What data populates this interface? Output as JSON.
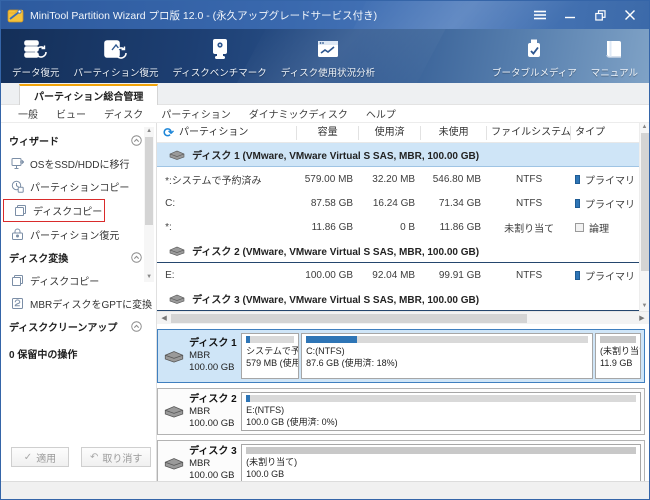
{
  "window": {
    "title": "MiniTool Partition Wizard プロ版 12.0 - (永久アップグレードサービス付き)"
  },
  "toolbar": {
    "items": [
      {
        "label": "データ復元",
        "icon": "data-recovery-icon"
      },
      {
        "label": "パーティション復元",
        "icon": "partition-recovery-icon"
      },
      {
        "label": "ディスクベンチマーク",
        "icon": "disk-benchmark-icon"
      },
      {
        "label": "ディスク使用状況分析",
        "icon": "disk-usage-analysis-icon"
      },
      {
        "label": "ブータブルメディア",
        "icon": "bootable-media-icon"
      },
      {
        "label": "マニュアル",
        "icon": "manual-icon"
      }
    ]
  },
  "tab": {
    "label": "パーティション総合管理"
  },
  "menu": {
    "items": [
      "一般",
      "ビュー",
      "ディスク",
      "パーティション",
      "ダイナミックディスク",
      "ヘルプ"
    ]
  },
  "sidebar": {
    "sections": [
      {
        "title": "ウィザード",
        "items": [
          {
            "label": "OSをSSD/HDDに移行"
          },
          {
            "label": "パーティションコピー"
          },
          {
            "label": "ディスクコピー",
            "highlighted": true
          },
          {
            "label": "パーティション復元"
          }
        ]
      },
      {
        "title": "ディスク変換",
        "items": [
          {
            "label": "ディスクコピー"
          },
          {
            "label": "MBRディスクをGPTに変換"
          }
        ]
      },
      {
        "title": "ディスククリーンアップ",
        "items": []
      }
    ],
    "pending_label": "0 保留中の操作"
  },
  "actions": {
    "apply_label": "適用",
    "undo_label": "取り消す"
  },
  "table": {
    "columns": {
      "name": "パーティション",
      "capacity": "容量",
      "used": "使用済",
      "unused": "未使用",
      "fs": "ファイルシステム",
      "type": "タイプ"
    },
    "disk1": {
      "label": "ディスク 1 (VMware, VMware Virtual S SAS, MBR, 100.00 GB)"
    },
    "disk2": {
      "label": "ディスク 2 (VMware, VMware Virtual S SAS, MBR, 100.00 GB)"
    },
    "disk3": {
      "label": "ディスク 3 (VMware, VMware Virtual S SAS, MBR, 100.00 GB)"
    },
    "rows": [
      {
        "name": "*:システムで予約済み",
        "capacity": "579.00 MB",
        "used": "32.20 MB",
        "unused": "546.80 MB",
        "fs": "NTFS",
        "type": "プライマリ",
        "type_kind": "primary"
      },
      {
        "name": "C:",
        "capacity": "87.58 GB",
        "used": "16.24 GB",
        "unused": "71.34 GB",
        "fs": "NTFS",
        "type": "プライマリ",
        "type_kind": "primary"
      },
      {
        "name": "*:",
        "capacity": "11.86 GB",
        "used": "0 B",
        "unused": "11.86 GB",
        "fs": "未割り当て",
        "type": "論理",
        "type_kind": "logical"
      },
      {
        "name": "E:",
        "capacity": "100.00 GB",
        "used": "92.04 MB",
        "unused": "99.91 GB",
        "fs": "NTFS",
        "type": "プライマリ",
        "type_kind": "primary"
      }
    ]
  },
  "diskmap": {
    "disks": [
      {
        "name": "ディスク 1",
        "scheme": "MBR",
        "size": "100.00 GB",
        "selected": true,
        "blocks": [
          {
            "line1": "システムで予約",
            "line2": "579 MB (使用",
            "usage_pct": 8,
            "kind": "ntfs"
          },
          {
            "line1": "C:(NTFS)",
            "line2": "87.6 GB (使用済: 18%)",
            "usage_pct": 18,
            "kind": "ntfs"
          },
          {
            "line1": "(未割り当て)",
            "line2": "11.9 GB",
            "usage_pct": 0,
            "kind": "unallocated"
          }
        ]
      },
      {
        "name": "ディスク 2",
        "scheme": "MBR",
        "size": "100.00 GB",
        "selected": false,
        "blocks": [
          {
            "line1": "E:(NTFS)",
            "line2": "100.0 GB (使用済: 0%)",
            "usage_pct": 1,
            "kind": "ntfs"
          }
        ]
      },
      {
        "name": "ディスク 3",
        "scheme": "MBR",
        "size": "100.00 GB",
        "selected": false,
        "blocks": [
          {
            "line1": "(未割り当て)",
            "line2": "100.0 GB",
            "usage_pct": 0,
            "kind": "unallocated"
          }
        ]
      }
    ]
  },
  "colors": {
    "titlebar_blue": "#3565a8",
    "toolbar_dark": "#142f58",
    "tab_accent": "#f0a30a",
    "selection_fill": "#cfe5f7",
    "selection_border": "#3f7fbf",
    "primary_square": "#2e75b6",
    "usage_bar_fill": "#2e75b6",
    "highlight_red": "#d92b2b"
  }
}
